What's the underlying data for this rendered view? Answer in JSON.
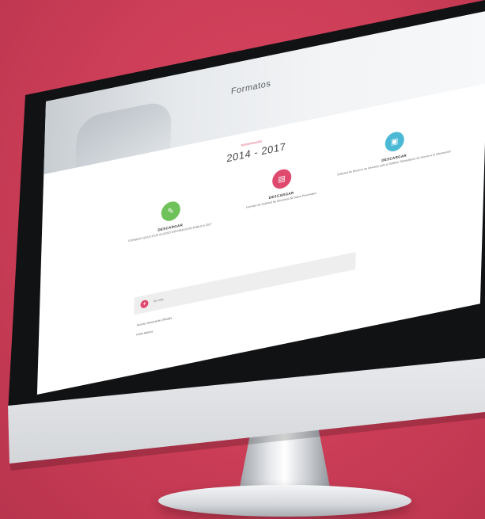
{
  "page": {
    "hero_title": "Formatos",
    "years_caption": "Administración",
    "years": "2014 - 2017"
  },
  "cards": [
    {
      "label": "DESCARGAR",
      "desc": "FORMATO SOLICITUD ACCESO INFORMACION PÚBLICA 2017",
      "color": "#6fc25a",
      "icon": "document-icon"
    },
    {
      "label": "DESCARGAR",
      "desc": "Formato de Solicitud de Derechos de Datos Personales",
      "color": "#e0496e",
      "icon": "printer-icon"
    },
    {
      "label": "DESCARGAR",
      "desc": "Solicitud de Recurso de Revisión ante el Instituto Tamaulipeco de Acceso a la Información",
      "color": "#4bb9d6",
      "icon": "file-icon"
    }
  ],
  "accordion": {
    "label": "Ver más"
  },
  "links": [
    "Acceso General de Oficialía",
    "Ficha Básica"
  ],
  "colors": {
    "background": "#cc3d57",
    "accent": "#e0496e"
  }
}
